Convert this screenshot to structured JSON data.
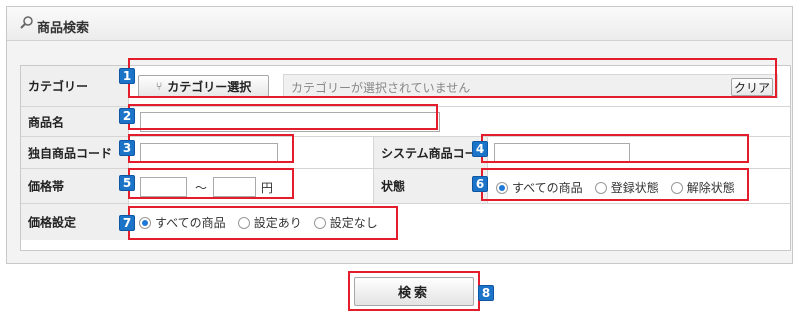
{
  "panel": {
    "title": "商品検索",
    "icon": "search-icon"
  },
  "fields": {
    "category": {
      "label": "カテゴリー",
      "button_label": "カテゴリー選択",
      "placeholder_text": "カテゴリーが選択されていません",
      "clear_label": "クリア",
      "button_icon": "category-tree-icon"
    },
    "product_name": {
      "label": "商品名",
      "value": ""
    },
    "own_code": {
      "label": "独自商品コード",
      "value": ""
    },
    "system_code": {
      "label": "システム商品コー",
      "value": ""
    },
    "price_range": {
      "label": "価格帯",
      "min": "",
      "max": "",
      "separator": "～",
      "unit": "円"
    },
    "status": {
      "label": "状態",
      "options": [
        "すべての商品",
        "登録状態",
        "解除状態"
      ],
      "selected": 0
    },
    "price_setting": {
      "label": "価格設定",
      "options": [
        "すべての商品",
        "設定あり",
        "設定なし"
      ],
      "selected": 0
    }
  },
  "submit": {
    "label": "検索"
  },
  "annotations": [
    "1",
    "2",
    "3",
    "4",
    "5",
    "6",
    "7",
    "8"
  ],
  "colors": {
    "highlight_border": "#e31d2b",
    "badge_background": "#1c74c9",
    "radio_selected": "#1e78d7"
  }
}
